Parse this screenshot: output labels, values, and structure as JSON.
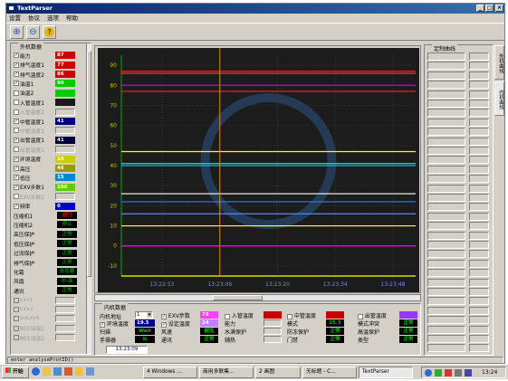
{
  "window": {
    "title": "TextParser"
  },
  "menu": [
    "设置",
    "协议",
    "选项",
    "帮助"
  ],
  "left_panel": {
    "title": "外机数据",
    "rows": [
      {
        "label": "能力",
        "checked": true,
        "value": "87",
        "color": "#cc0000"
      },
      {
        "label": "排气温度1",
        "checked": true,
        "value": "77",
        "color": "#cc0000"
      },
      {
        "label": "排气温度2",
        "checked": true,
        "value": "86",
        "color": "#cc0000"
      },
      {
        "label": "油温1",
        "checked": true,
        "value": "90",
        "color": "#00cc00"
      },
      {
        "label": "油温2",
        "checked": false,
        "value": "",
        "color": "#00cc00"
      },
      {
        "label": "入管温度1",
        "checked": false,
        "value": "",
        "color": "#1a1a1a"
      },
      {
        "label": "入管温度2",
        "checked": false,
        "value": "",
        "color": "",
        "grey": true
      },
      {
        "label": "中管温度1",
        "checked": true,
        "value": "41",
        "color": "#000080"
      },
      {
        "label": "中管温度2",
        "checked": false,
        "value": "",
        "color": "",
        "grey": true
      },
      {
        "label": "出管温度1",
        "checked": true,
        "value": "41",
        "color": "#00003a"
      },
      {
        "label": "出管温度2",
        "checked": false,
        "value": "",
        "color": "",
        "grey": true
      },
      {
        "label": "环境温度",
        "checked": true,
        "value": "10",
        "color": "#cccc00"
      },
      {
        "label": "高压",
        "checked": true,
        "value": "46",
        "color": "#999900"
      },
      {
        "label": "低压",
        "checked": true,
        "value": "15",
        "color": "#0088cc"
      },
      {
        "label": "EXV步数1",
        "checked": true,
        "value": "100",
        "color": "#66cc00"
      },
      {
        "label": "EXV步数2",
        "checked": false,
        "value": "",
        "color": "",
        "grey": true
      },
      {
        "label": "频率",
        "checked": true,
        "value": "0",
        "color": "#0000cc"
      }
    ],
    "status_rows": [
      {
        "label": "压缩机1",
        "value": "运行",
        "value_color": "#ff0000"
      },
      {
        "label": "压缩机2",
        "value": "停止",
        "value_color": "#008000"
      },
      {
        "label": "高压保护",
        "value": "正常",
        "value_color": "#008000"
      },
      {
        "label": "低压保护",
        "value": "正常",
        "value_color": "#008000"
      },
      {
        "label": "过流保护",
        "value": "正常",
        "value_color": "#008000"
      },
      {
        "label": "排气保护",
        "value": "正常",
        "value_color": "#008000"
      },
      {
        "label": "化霜",
        "value": "未化霜",
        "value_color": "#008000"
      },
      {
        "label": "风扇",
        "value": "中-高",
        "value_color": "#008000"
      },
      {
        "label": "通讯",
        "value": "正常",
        "value_color": "#008000"
      }
    ],
    "grey_rows": [
      "Exv1",
      "Exv3",
      "SvExv4",
      "制冷油温1",
      "制冷油温2"
    ]
  },
  "chart_data": {
    "type": "line",
    "title": "",
    "yticks": [
      "90",
      "80",
      "70",
      "60",
      "50",
      "40",
      "30",
      "20",
      "10",
      "0",
      "-10"
    ],
    "ylim": [
      -15,
      95
    ],
    "xticks": [
      "13:22:53",
      "13:23:06",
      "13:23:20",
      "13:23:34",
      "13:23:48"
    ],
    "grid": true,
    "series": [
      {
        "value": 87,
        "color": "#ff1a1a"
      },
      {
        "value": 86,
        "color": "#ff3333"
      },
      {
        "value": 80,
        "color": "#cc00cc"
      },
      {
        "value": 77,
        "color": "#ff2222"
      },
      {
        "value": 47,
        "color": "#ffff00"
      },
      {
        "value": 41,
        "color": "#00ff88"
      },
      {
        "value": 40,
        "color": "#2aa0ff"
      },
      {
        "value": 26,
        "color": "#ffffff"
      },
      {
        "value": 22,
        "color": "#3377ff"
      },
      {
        "value": 16,
        "color": "#5588ff"
      },
      {
        "value": 10,
        "color": "#ffff66"
      },
      {
        "value": 0,
        "color": "#ff00ff"
      },
      {
        "value": -15,
        "color": "#ffff00"
      }
    ],
    "cursor_time": "13:23:06"
  },
  "indoor": {
    "title": "内机数据",
    "addr_label": "内机地址",
    "addr_value": "1",
    "env_temp_label": "环境温度",
    "env_temp_value": "19.5",
    "scan_label": "扫描",
    "scan_value": "Wait",
    "manual_label": "手操器",
    "manual_value": "从",
    "time_value": "13:23:09",
    "exv_label": "EXV步数",
    "set_temp_label": "设定温度",
    "windspeed_label": "风速",
    "comm_label": "通讯",
    "exv_value": "76",
    "set_temp_value": "24",
    "windspeed_value": "超低",
    "comm_value": "正常",
    "inlet_temp_label": "入管温度",
    "capacity_label": "能力",
    "water_full_label": "水满保护",
    "aux_heat_label": "辅热",
    "mid_temp_label": "中管温度",
    "mode_label": "模式",
    "freeze_label": "防冻保护",
    "door_label": "门禁",
    "mid_temp_value": "25.5",
    "mode_value": "超低",
    "freeze_value": "正常",
    "door_value": "正常",
    "out_temp_label": "出管温度",
    "mode_conflict_label": "模式冲突",
    "hp_protect_label": "高温保护",
    "type_label": "类型",
    "out_temp_value": "无机",
    "mode_conflict_value": "正常",
    "hp_protect_value": "正常",
    "type_value": "正常"
  },
  "right_panel": {
    "title": "定制曲线",
    "tabs": [
      "外机曲线",
      "内机曲线"
    ]
  },
  "statusbar": {
    "text": "enter analyseProtID()"
  },
  "taskbar": {
    "start": "开始",
    "items": [
      "4 Windows ...",
      "商用多联集...",
      "2 画图",
      "无标题 - C...",
      "TextParser"
    ],
    "clock": "13:24"
  }
}
